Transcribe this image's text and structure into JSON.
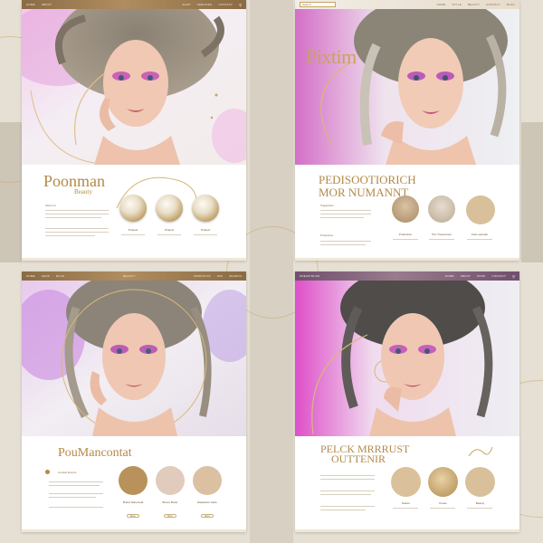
{
  "colors": {
    "gold": "#c9a25e",
    "bronze_nav": "#8a6b45",
    "plum_nav": "#6f4f6d",
    "magenta": "#d455c0",
    "cream": "#e6e0d4"
  },
  "mockup1": {
    "nav": [
      "Home",
      "About",
      "Shop",
      "Services",
      "Contact"
    ],
    "brand": "Poonman",
    "brand_sub": "Beauty",
    "subhead": "About us",
    "captions": [
      "Product",
      "Product",
      "Product"
    ]
  },
  "mockup2": {
    "search_placeholder": "Search...",
    "nav": [
      "Home",
      "Style",
      "Beauty",
      "Contact",
      "Blog"
    ],
    "hero_title": "Pixtim",
    "heading": [
      "PEDISOOTIORICH",
      "MOR NUMANNT"
    ],
    "subhead": "Suggestion",
    "subhead2": "Production",
    "captions": [
      "Production",
      "Pirc Tresponses",
      "Face samplet"
    ]
  },
  "mockup3": {
    "nav": [
      "Home",
      "Shop",
      "Blog",
      "Beauty"
    ],
    "nav_right": [
      "Products",
      "Nav",
      "Search"
    ],
    "heading": "PouMancontat",
    "subhead": "Contact Events",
    "captions": [
      "Brand Nacunnall",
      "Brown Bossr",
      "Elaskelum Saze"
    ],
    "buttons": [
      "More",
      "More",
      "More"
    ]
  },
  "mockup4": {
    "nav": [
      "Dream Bliss",
      "Home",
      "About",
      "Shop",
      "Contact"
    ],
    "heading": [
      "PELCK MRRRUST",
      "OUTTENIR"
    ],
    "captions": [
      "Nature",
      "Cream",
      "Beauty"
    ]
  }
}
